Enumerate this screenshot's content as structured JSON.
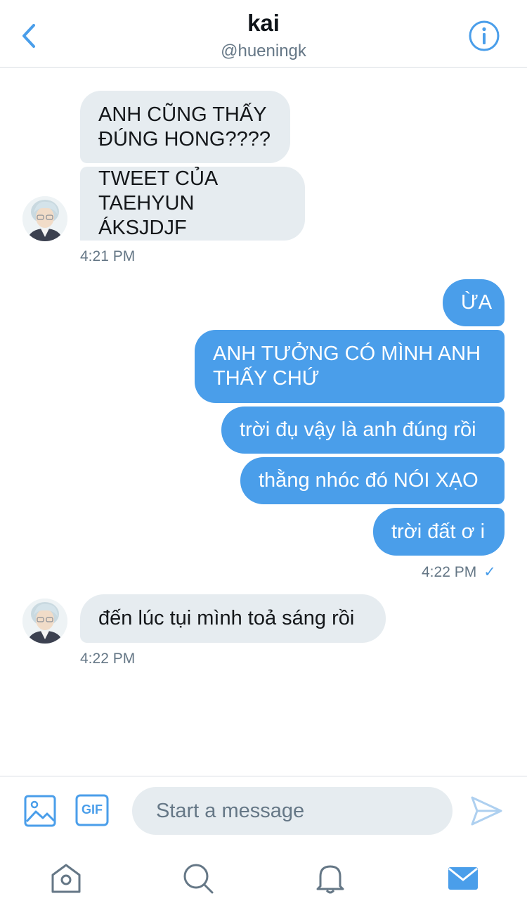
{
  "header": {
    "name": "kai",
    "handle": "@hueningk"
  },
  "messages": {
    "group1": {
      "m1": "ANH CŨNG THẤY\nĐÚNG HONG????",
      "m2": "TWEET CỦA\nTAEHYUN ÁKSJDJF",
      "time": "4:21 PM"
    },
    "group2": {
      "m1": "ỪA",
      "m2": "ANH TƯỞNG CÓ MÌNH ANH\nTHẤY CHỨ",
      "m3": "trời đụ vậy là anh đúng rồi",
      "m4": "thằng nhóc đó NÓI XẠO",
      "m5": "trời đất ơ i",
      "time": "4:22 PM",
      "status": "✓"
    },
    "group3": {
      "m1": "đến lúc tụi mình toả sáng rồi",
      "time": "4:22 PM"
    }
  },
  "composer": {
    "placeholder": "Start a message",
    "gif_label": "GIF"
  },
  "colors": {
    "accent": "#4a9eea",
    "incoming_bubble": "#e6ecf0",
    "outgoing_bubble": "#4a9eea",
    "muted_text": "#657786"
  },
  "icons": {
    "back": "chevron-left-icon",
    "info": "info-icon",
    "image": "image-icon",
    "gif": "gif-icon",
    "send": "send-icon",
    "home": "home-icon",
    "search": "search-icon",
    "notifications": "bell-icon",
    "messages": "mail-icon"
  }
}
